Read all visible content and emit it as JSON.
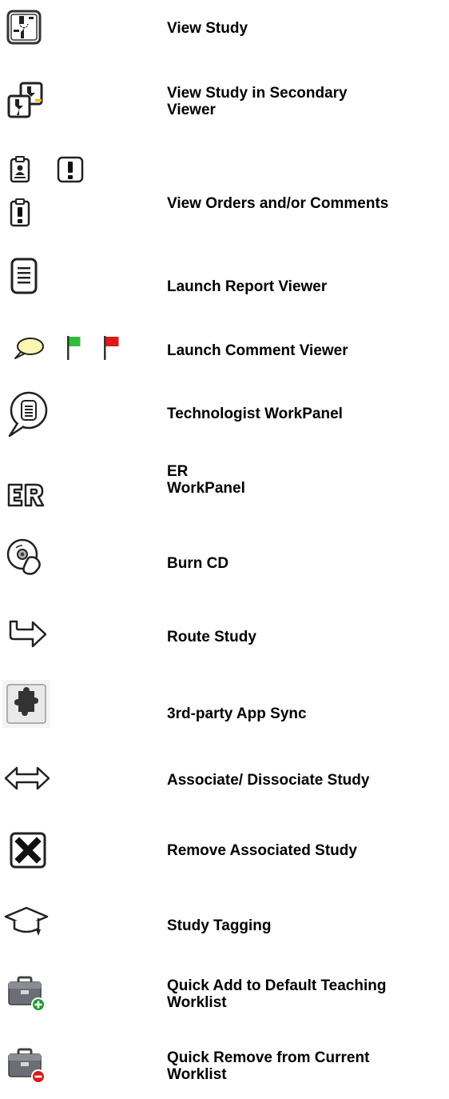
{
  "legend": {
    "rows": [
      {
        "label": "View Study",
        "icons": [
          "view-study-icon"
        ]
      },
      {
        "label": "View Study in Secondary\nViewer",
        "icons": [
          "secondary-viewer-icon"
        ]
      },
      {
        "label": "View Orders and/or Comments",
        "icons": [
          "order-clipboard-icon",
          "exclamation-icon",
          "clipboard-exclamation-icon"
        ]
      },
      {
        "label": "Launch Report Viewer",
        "icons": [
          "report-document-icon"
        ]
      },
      {
        "label": "Launch Comment Viewer",
        "icons": [
          "speech-bubble-icon",
          "green-flag-icon",
          "red-flag-icon"
        ]
      },
      {
        "label": "Technologist WorkPanel",
        "icons": [
          "technologist-bubble-icon"
        ]
      },
      {
        "label": "ER\nWorkPanel",
        "icons": [
          "er-icon"
        ]
      },
      {
        "label": "Burn CD",
        "icons": [
          "burn-cd-icon"
        ]
      },
      {
        "label": "Route Study",
        "icons": [
          "route-arrow-icon"
        ]
      },
      {
        "label": "3rd-party App Sync",
        "icons": [
          "puzzle-sync-icon"
        ]
      },
      {
        "label": "Associate/ Dissociate Study",
        "icons": [
          "double-arrow-icon"
        ]
      },
      {
        "label": "Remove Associated Study",
        "icons": [
          "remove-x-icon"
        ]
      },
      {
        "label": "Study Tagging",
        "icons": [
          "graduation-cap-icon"
        ]
      },
      {
        "label": "Quick Add to Default Teaching\nWorklist",
        "icons": [
          "briefcase-add-icon"
        ]
      },
      {
        "label": "Quick Remove from Current\nWorklist",
        "icons": [
          "briefcase-remove-icon"
        ]
      }
    ]
  },
  "colors": {
    "icon_stroke": "#333333",
    "comment_bubble_fill": "#fdf6b0",
    "green_flag": "#2fbf3a",
    "red_flag": "#e01818",
    "add_badge": "#1e9a30",
    "remove_badge": "#d81a1a"
  }
}
